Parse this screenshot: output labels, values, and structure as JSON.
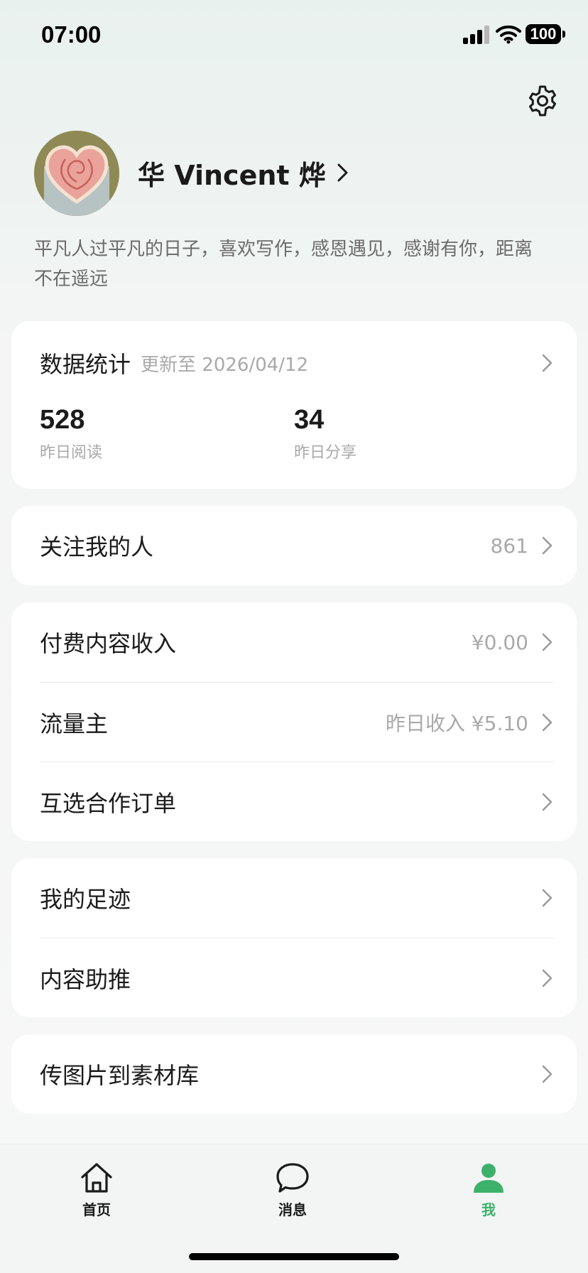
{
  "status_bar": {
    "time": "07:00",
    "battery": "100"
  },
  "profile": {
    "name": "华 Vincent 烨",
    "bio": "平凡人过平凡的日子，喜欢写作，感恩遇见，感谢有你，距离不在遥远"
  },
  "stats": {
    "title": "数据统计",
    "updated": "更新至 2026/04/12",
    "read_value": "528",
    "read_label": "昨日阅读",
    "share_value": "34",
    "share_label": "昨日分享"
  },
  "followers": {
    "label": "关注我的人",
    "value": "861"
  },
  "income": {
    "paid_label": "付费内容收入",
    "paid_value": "¥0.00",
    "traffic_label": "流量主",
    "traffic_value": "昨日收入 ¥5.10",
    "orders_label": "互选合作订单"
  },
  "misc": {
    "footprint_label": "我的足迹",
    "promote_label": "内容助推"
  },
  "upload": {
    "label": "传图片到素材库"
  },
  "tabs": [
    {
      "label": "首页",
      "icon": "home-icon"
    },
    {
      "label": "消息",
      "icon": "message-icon"
    },
    {
      "label": "我",
      "icon": "person-icon"
    }
  ],
  "colors": {
    "accent": "#3db16a",
    "muted": "#a9a9a9"
  }
}
